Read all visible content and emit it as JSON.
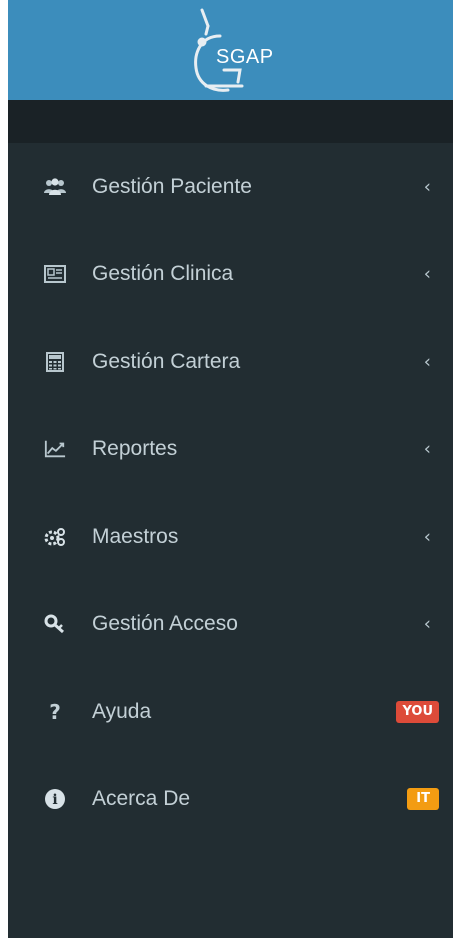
{
  "brand": {
    "logo_text": "SGAP"
  },
  "menu": {
    "items": [
      {
        "label": "Gestión Paciente",
        "icon": "users-icon",
        "chevron": "‹"
      },
      {
        "label": "Gestión Clinica",
        "icon": "id-card-icon",
        "chevron": "‹"
      },
      {
        "label": "Gestión Cartera",
        "icon": "calculator-icon",
        "chevron": "‹"
      },
      {
        "label": "Reportes",
        "icon": "line-chart-icon",
        "chevron": "‹"
      },
      {
        "label": "Maestros",
        "icon": "gears-icon",
        "chevron": "‹"
      },
      {
        "label": "Gestión Acceso",
        "icon": "key-icon",
        "chevron": "‹"
      },
      {
        "label": "Ayuda",
        "icon": "question-icon",
        "glyph": "?",
        "badge": "YOU"
      },
      {
        "label": "Acerca De",
        "icon": "info-circle-icon",
        "glyph": "i",
        "badge": "IT"
      }
    ]
  },
  "colors": {
    "brand_bg": "#3c8dbc",
    "sidebar_bg": "#222d32",
    "subbar_bg": "#1a2226",
    "text": "#b8c7ce",
    "badge_red": "#dd4b39",
    "badge_orange": "#f39c12"
  }
}
